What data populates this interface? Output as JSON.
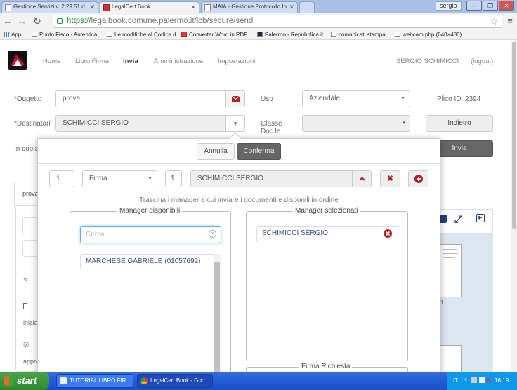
{
  "browser": {
    "tabs": [
      {
        "title": "Gestione Servizi v. 2.29.51 d",
        "active": false
      },
      {
        "title": "LegalCert Book",
        "active": true
      },
      {
        "title": "MAIA - Gestione Protocollo In",
        "active": false
      }
    ],
    "user": "sergio",
    "url_scheme": "https://",
    "url_rest": "legalbook.comune.palermo.it/lcb/secure/send",
    "bookmarks": [
      "App",
      "Punto Fisco - Autentica...",
      "Le modifiche al Codice d",
      "Converter Word in PDF",
      "Palermo - Repubblica.it",
      "comunicati stampa",
      "webcam.php (640×480)"
    ]
  },
  "nav": {
    "items": [
      "Home",
      "Libro Firma",
      "Invia",
      "Amministrazione",
      "Impostazioni"
    ],
    "active_index": 2,
    "user_name": "SERGIO SCHIMICCI",
    "logout": "(logout)"
  },
  "form": {
    "oggetto_label": "*Oggetto",
    "oggetto_value": "prova",
    "uso_label": "Uso",
    "uso_value": "Aziendale",
    "plico_id": "Plico ID: 2394",
    "destinatari_label": "*Destinatari",
    "destinatari_value": "SCHIMICCI SERGIO",
    "classe_label": "Classe Doc.le",
    "classe_value": "",
    "indietro": "Indietro",
    "copia_label": "In copia",
    "invia": "Invia",
    "tab_label": "prova",
    "side_text_1": "inizia",
    "side_text_2": "appro"
  },
  "popup": {
    "annulla": "Annulla",
    "conferma": "Conferma",
    "row": {
      "order": "1",
      "type": "Firma",
      "count": "1",
      "name": "SCHIMICCI SERGIO"
    },
    "instructions": "Trascina i manager a cui inviare i documenti e disponili in ordine",
    "available_legend": "Manager disponibili",
    "search_placeholder": "Cerca...",
    "available": [
      "MARCHESE GABRIELE (01057692)"
    ],
    "selected_legend": "Manager selezionati",
    "selected": [
      "SCHIMICCI SERGIO"
    ],
    "firma_legend": "Firma Richiesta"
  },
  "preview": {
    "page_number": "1"
  },
  "taskbar": {
    "start": "start",
    "tasks": [
      "TUTORIAL LIBRO FIR...",
      "LegalCert Book - Goo..."
    ],
    "tray_lang": "IT",
    "time": "16.19"
  },
  "colors": {
    "accent_red": "#b22222",
    "dark_button": "#666666"
  }
}
